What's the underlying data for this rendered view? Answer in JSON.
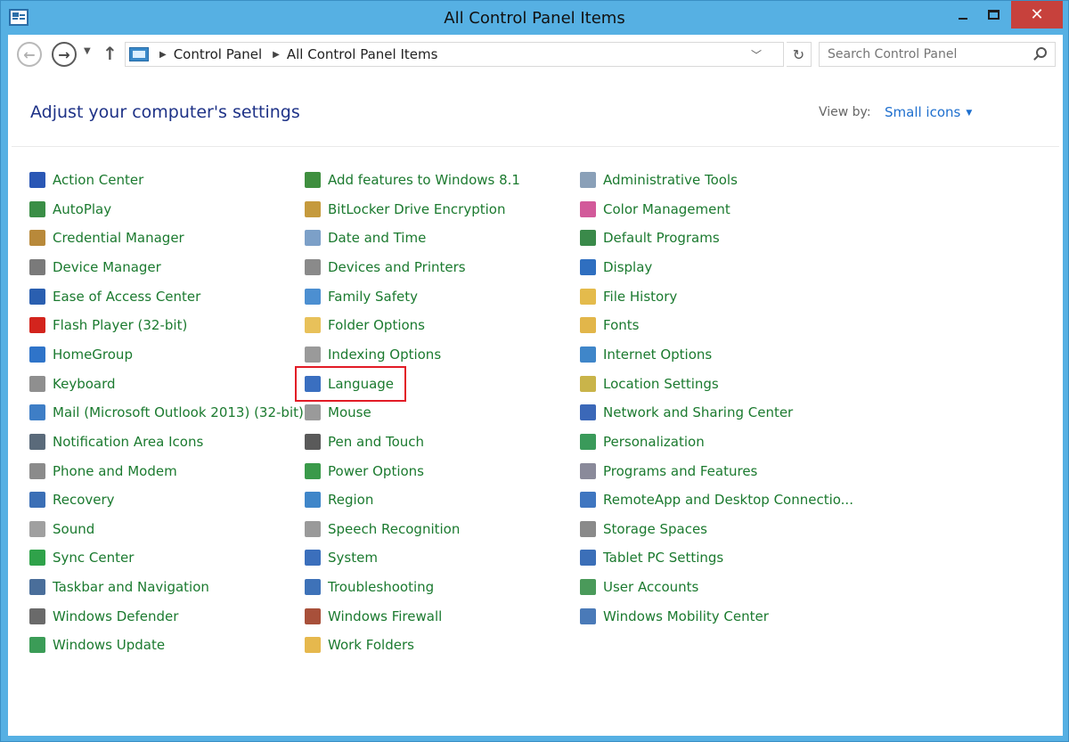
{
  "window": {
    "title": "All Control Panel Items"
  },
  "nav": {
    "breadcrumb": [
      "Control Panel",
      "All Control Panel Items"
    ],
    "search_placeholder": "Search Control Panel"
  },
  "header": {
    "heading": "Adjust your computer's settings",
    "view_by_label": "View by:",
    "view_by_value": "Small icons"
  },
  "columns": [
    {
      "items": [
        {
          "label": "Action Center",
          "icon": "flag-icon",
          "color": "#2a57b5"
        },
        {
          "label": "AutoPlay",
          "icon": "autoplay-icon",
          "color": "#3a8e46"
        },
        {
          "label": "Credential Manager",
          "icon": "vault-icon",
          "color": "#b8893a"
        },
        {
          "label": "Device Manager",
          "icon": "device-manager-icon",
          "color": "#7a7a7a"
        },
        {
          "label": "Ease of Access Center",
          "icon": "ease-of-access-icon",
          "color": "#2a5fb0"
        },
        {
          "label": "Flash Player (32-bit)",
          "icon": "flash-icon",
          "color": "#d3241d"
        },
        {
          "label": "HomeGroup",
          "icon": "homegroup-icon",
          "color": "#2f74c9"
        },
        {
          "label": "Keyboard",
          "icon": "keyboard-icon",
          "color": "#8f8f8f"
        },
        {
          "label": "Mail (Microsoft Outlook 2013) (32-bit)",
          "icon": "mail-icon",
          "color": "#3e7ec6"
        },
        {
          "label": "Notification Area Icons",
          "icon": "notification-icon",
          "color": "#5a6a7a"
        },
        {
          "label": "Phone and Modem",
          "icon": "phone-icon",
          "color": "#8b8b8b"
        },
        {
          "label": "Recovery",
          "icon": "recovery-icon",
          "color": "#3b6fb6"
        },
        {
          "label": "Sound",
          "icon": "sound-icon",
          "color": "#a0a0a0"
        },
        {
          "label": "Sync Center",
          "icon": "sync-icon",
          "color": "#2fa24a"
        },
        {
          "label": "Taskbar and Navigation",
          "icon": "taskbar-icon",
          "color": "#4a6e9a"
        },
        {
          "label": "Windows Defender",
          "icon": "defender-icon",
          "color": "#6a6a6a"
        },
        {
          "label": "Windows Update",
          "icon": "update-icon",
          "color": "#3b9c57"
        }
      ]
    },
    {
      "items": [
        {
          "label": "Add features to Windows 8.1",
          "icon": "add-features-icon",
          "color": "#3f8f3f"
        },
        {
          "label": "BitLocker Drive Encryption",
          "icon": "bitlocker-icon",
          "color": "#c59a3d"
        },
        {
          "label": "Date and Time",
          "icon": "clock-icon",
          "color": "#7ca0c8"
        },
        {
          "label": "Devices and Printers",
          "icon": "printer-icon",
          "color": "#8a8a8a"
        },
        {
          "label": "Family Safety",
          "icon": "family-icon",
          "color": "#4c8fd1"
        },
        {
          "label": "Folder Options",
          "icon": "folder-options-icon",
          "color": "#e8c15a"
        },
        {
          "label": "Indexing Options",
          "icon": "indexing-icon",
          "color": "#9a9a9a"
        },
        {
          "label": "Language",
          "icon": "language-icon",
          "color": "#3a6fc0"
        },
        {
          "label": "Mouse",
          "icon": "mouse-icon",
          "color": "#9a9a9a"
        },
        {
          "label": "Pen and Touch",
          "icon": "pen-icon",
          "color": "#5a5a5a"
        },
        {
          "label": "Power Options",
          "icon": "power-icon",
          "color": "#3a9a4a"
        },
        {
          "label": "Region",
          "icon": "region-icon",
          "color": "#3f86c9"
        },
        {
          "label": "Speech Recognition",
          "icon": "microphone-icon",
          "color": "#9a9a9a"
        },
        {
          "label": "System",
          "icon": "system-icon",
          "color": "#3b6fbc"
        },
        {
          "label": "Troubleshooting",
          "icon": "troubleshooting-icon",
          "color": "#3e72b8"
        },
        {
          "label": "Windows Firewall",
          "icon": "firewall-icon",
          "color": "#a8503a"
        },
        {
          "label": "Work Folders",
          "icon": "work-folders-icon",
          "color": "#e6b84d"
        }
      ]
    },
    {
      "items": [
        {
          "label": "Administrative Tools",
          "icon": "admin-tools-icon",
          "color": "#8aa0b8"
        },
        {
          "label": "Color Management",
          "icon": "color-management-icon",
          "color": "#d25a9a"
        },
        {
          "label": "Default Programs",
          "icon": "default-programs-icon",
          "color": "#3a8a4a"
        },
        {
          "label": "Display",
          "icon": "display-icon",
          "color": "#2f6fc0"
        },
        {
          "label": "File History",
          "icon": "file-history-icon",
          "color": "#e4bb4c"
        },
        {
          "label": "Fonts",
          "icon": "fonts-icon",
          "color": "#e2b64a"
        },
        {
          "label": "Internet Options",
          "icon": "internet-options-icon",
          "color": "#3f86c9"
        },
        {
          "label": "Location Settings",
          "icon": "location-icon",
          "color": "#c9b44a"
        },
        {
          "label": "Network and Sharing Center",
          "icon": "network-icon",
          "color": "#3b68b8"
        },
        {
          "label": "Personalization",
          "icon": "personalization-icon",
          "color": "#3a9a5a"
        },
        {
          "label": "Programs and Features",
          "icon": "programs-icon",
          "color": "#8a8a9a"
        },
        {
          "label": "RemoteApp and Desktop Connectio...",
          "icon": "remoteapp-icon",
          "color": "#3f76c0"
        },
        {
          "label": "Storage Spaces",
          "icon": "storage-icon",
          "color": "#8a8a8a"
        },
        {
          "label": "Tablet PC Settings",
          "icon": "tablet-icon",
          "color": "#3b6fb8"
        },
        {
          "label": "User Accounts",
          "icon": "user-accounts-icon",
          "color": "#4a9a5a"
        },
        {
          "label": "Windows Mobility Center",
          "icon": "mobility-icon",
          "color": "#4a7ab8"
        }
      ]
    }
  ],
  "highlighted_item": "Language",
  "colors": {
    "link_green": "#1b7a2f",
    "heading_blue": "#1e3287",
    "highlight_red": "#e21b26",
    "close_red": "#c7413c"
  }
}
